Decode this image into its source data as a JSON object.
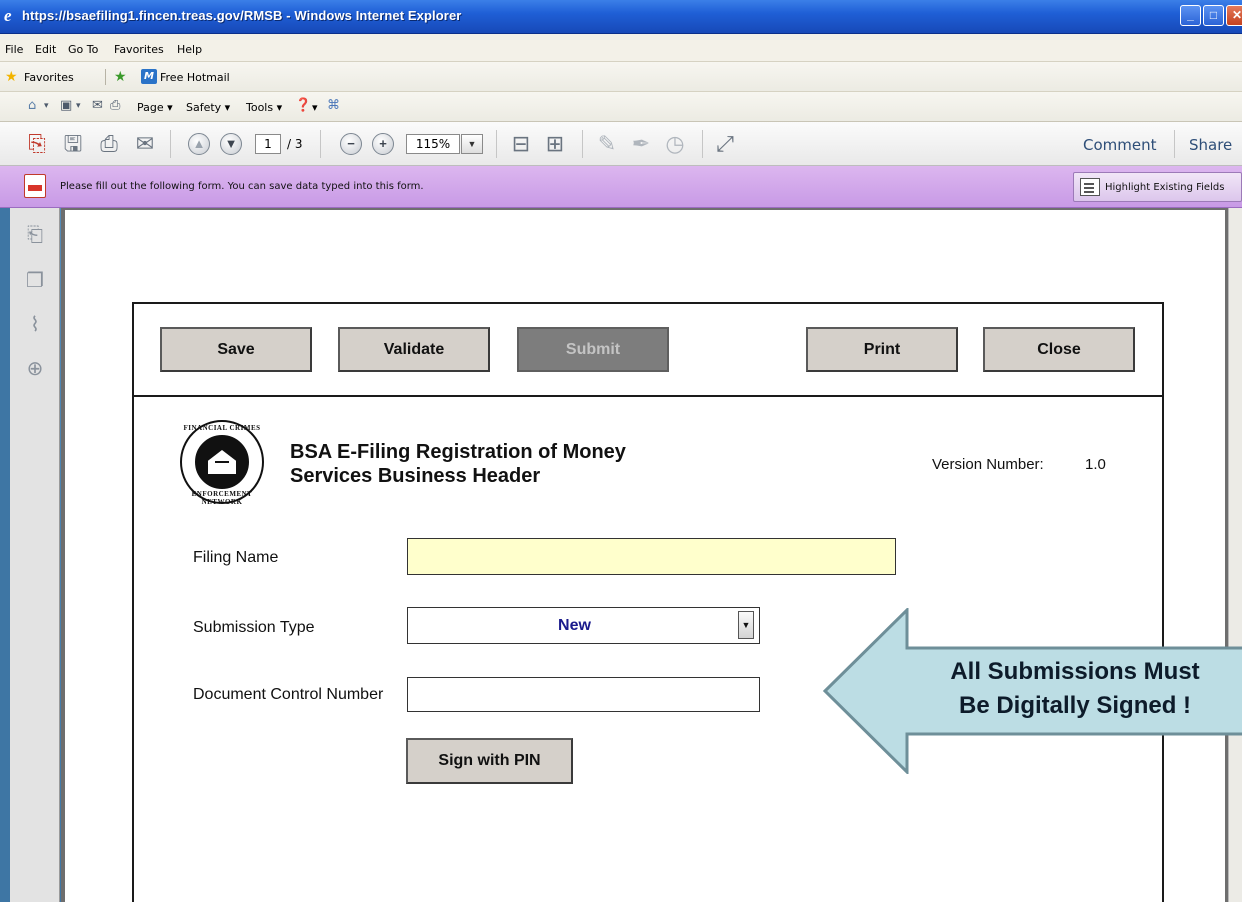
{
  "window": {
    "title": "https://bsaefiling1.fincen.treas.gov/RMSB - Windows Internet Explorer",
    "controls": {
      "minimize": "_",
      "maximize": "□",
      "close": "✕"
    }
  },
  "menu": {
    "items": [
      "File",
      "Edit",
      "Go To",
      "Favorites",
      "Help"
    ]
  },
  "favorites_bar": {
    "favorites_label": "Favorites",
    "hotmail_icon_letter": "M",
    "hotmail_label": "Free Hotmail"
  },
  "command_bar": {
    "page_label": "Page ▾",
    "safety_label": "Safety ▾",
    "tools_label": "Tools ▾",
    "help_label": "▾"
  },
  "acrobat_toolbar": {
    "current_page": "1",
    "total_pages": "/ 3",
    "zoom": "115%",
    "comment_label": "Comment",
    "share_label": "Share"
  },
  "form_bar": {
    "message": "Please fill out the following form. You can save data typed into this form.",
    "highlight_label": "Highlight Existing Fields"
  },
  "form": {
    "buttons": {
      "save": "Save",
      "validate": "Validate",
      "submit": "Submit",
      "print": "Print",
      "close": "Close"
    },
    "seal": {
      "top_text": "FINANCIAL CRIMES",
      "bottom_text": "ENFORCEMENT NETWORK"
    },
    "title_line1": "BSA E-Filing Registration of Money",
    "title_line2": "Services Business Header",
    "version_label": "Version Number:",
    "version_value": "1.0",
    "filing_name_label": "Filing Name",
    "filing_name_value": "",
    "submission_type_label": "Submission Type",
    "submission_type_value": "New",
    "dcn_label": "Document Control Number",
    "dcn_value": "",
    "sign_button": "Sign with PIN"
  },
  "callout": {
    "line1": "All Submissions Must",
    "line2": "Be Digitally Signed !",
    "fill_color": "#bcdde4",
    "stroke_color": "#6e8f99"
  }
}
